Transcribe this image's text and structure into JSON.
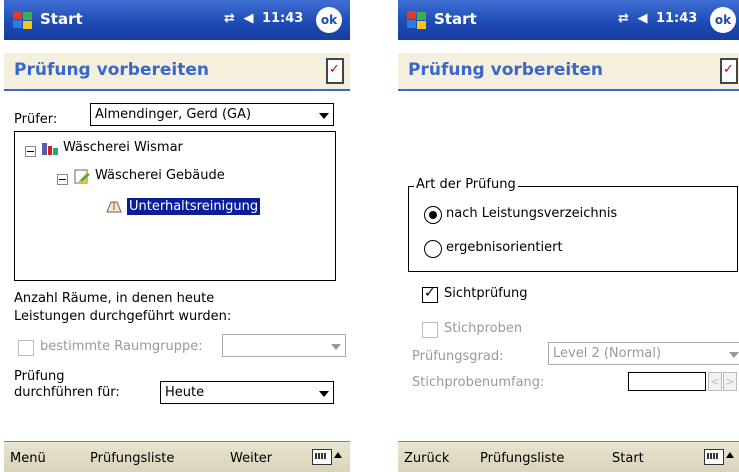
{
  "left": {
    "titlebar": {
      "start": "Start",
      "time": "11:43",
      "ok": "ok"
    },
    "header": {
      "title": "Prüfung vorbereiten"
    },
    "pruefer": {
      "label": "Prüfer:",
      "value": "Almendinger, Gerd (GA)"
    },
    "tree": {
      "node1": "Wäscherei Wismar",
      "node2": "Wäscherei Gebäude",
      "node3": "Unterhaltsreinigung"
    },
    "anzahl_line1": "Anzahl Räume, in denen heute",
    "anzahl_line2": "Leistungen durchgeführt wurden:",
    "raumgruppe_label": "bestimmte Raumgruppe:",
    "pruefung_line1": "Prüfung",
    "pruefung_line2": "durchführen für:",
    "pruefung_value": "Heute",
    "menu": {
      "m1": "Menü",
      "m2": "Prüfungsliste",
      "m3": "Weiter"
    }
  },
  "right": {
    "titlebar": {
      "start": "Start",
      "time": "11:43",
      "ok": "ok"
    },
    "header": {
      "title": "Prüfung vorbereiten"
    },
    "group": {
      "title": "Art der Prüfung",
      "opt1": "nach Leistungsverzeichnis",
      "opt2": "ergebnisorientiert",
      "selected": "nach Leistungsverzeichnis"
    },
    "sicht": {
      "label": "Sichtprüfung",
      "checked": true
    },
    "stich": {
      "label": "Stichproben",
      "checked": false
    },
    "grad": {
      "label": "Prüfungsgrad:",
      "value": "Level 2 (Normal)"
    },
    "umfang": {
      "label": "Stichprobenumfang:"
    },
    "menu": {
      "m1": "Zurück",
      "m2": "Prüfungsliste",
      "m3": "Start"
    }
  },
  "icons": {
    "start": "windows-flag-icon",
    "connectivity": "connectivity-icon",
    "speaker": "speaker-icon",
    "clipboard": "clipboard-check-icon",
    "keyboard": "keyboard-icon"
  },
  "colors": {
    "titlebar": "#1d49b3",
    "header_text": "#3a68c8",
    "selection": "#0a1e9a",
    "menubar": "#e2dcc4"
  }
}
